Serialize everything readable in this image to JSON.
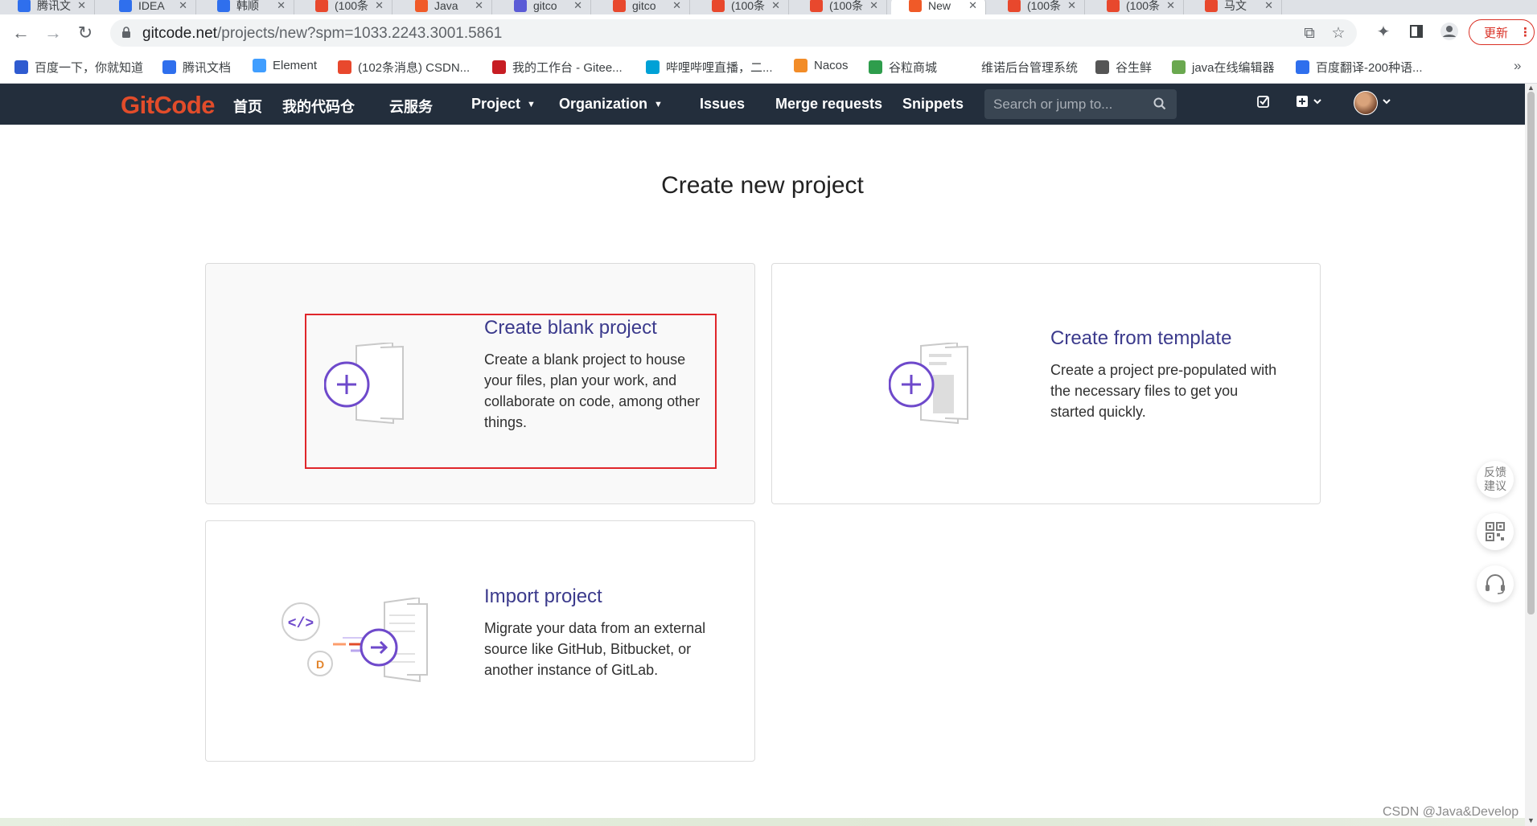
{
  "browser": {
    "tabs": [
      {
        "label": "腾讯文",
        "color": "#2f6fed"
      },
      {
        "label": "IDEA",
        "color": "#2f6fed"
      },
      {
        "label": "韩顺",
        "color": "#2f6fed"
      },
      {
        "label": "(100条",
        "color": "#e8482d"
      },
      {
        "label": "Java",
        "color": "#f05a28"
      },
      {
        "label": "gitco",
        "color": "#5b5bd6"
      },
      {
        "label": "gitco",
        "color": "#e8482d"
      },
      {
        "label": "(100条",
        "color": "#e8482d"
      },
      {
        "label": "(100条",
        "color": "#e8482d"
      },
      {
        "label": "New",
        "color": "#f05a28"
      },
      {
        "label": "(100条",
        "color": "#e8482d"
      },
      {
        "label": "(100条",
        "color": "#e8482d"
      },
      {
        "label": "马文",
        "color": "#e8482d"
      }
    ],
    "url_host": "gitcode.net",
    "url_path": "/projects/new?spm=1033.2243.3001.5861",
    "update_label": "更新",
    "bookmarks": [
      {
        "label": "百度一下，你就知道",
        "color": "#2f5bd0"
      },
      {
        "label": "腾讯文档",
        "color": "#2f6fed"
      },
      {
        "label": "Element",
        "color": "#409eff"
      },
      {
        "label": "(102条消息) CSDN...",
        "color": "#e8482d"
      },
      {
        "label": "我的工作台 - Gitee...",
        "color": "#c71d23"
      },
      {
        "label": "哔哩哔哩直播，二...",
        "color": "#00a1d6"
      },
      {
        "label": "Nacos",
        "color": "#f28c28"
      },
      {
        "label": "谷粒商城",
        "color": "#2e9d4c"
      },
      {
        "label": "维诺后台管理系统",
        "color": ""
      },
      {
        "label": "谷生鲜",
        "color": "#555555"
      },
      {
        "label": "java在线编辑器",
        "color": "#6aa84f"
      },
      {
        "label": "百度翻译-200种语...",
        "color": "#2f6fed"
      }
    ]
  },
  "navbar": {
    "logo": "GitCode",
    "links": [
      "首页",
      "我的代码仓",
      "云服务",
      "Project",
      "Organization",
      "Issues",
      "Merge requests",
      "Snippets"
    ],
    "search_placeholder": "Search or jump to..."
  },
  "page": {
    "title": "Create new project",
    "cards": [
      {
        "title": "Create blank project",
        "description": "Create a blank project to house your files, plan your work, and collaborate on code, among other things."
      },
      {
        "title": "Create from template",
        "description": "Create a project pre-populated with the necessary files to get you started quickly."
      },
      {
        "title": "Import project",
        "description": "Migrate your data from an external source like GitHub, Bitbucket, or another instance of GitLab."
      }
    ]
  },
  "widgets": {
    "feedback": [
      "反馈",
      "建议"
    ]
  },
  "watermark": "CSDN @Java&Develop",
  "colors": {
    "navbar_bg": "#232e3c",
    "brand": "#e24c2a",
    "accent_purple": "#6e49cb",
    "card_title": "#3b3a8c",
    "highlight_red": "#e0262b"
  }
}
